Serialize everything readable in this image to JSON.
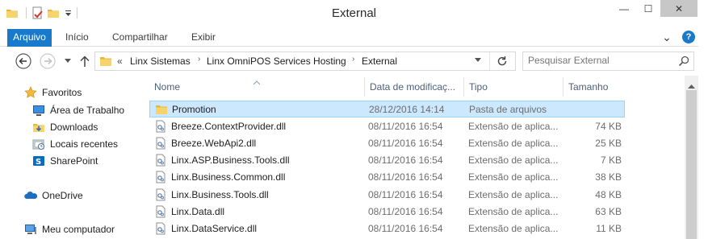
{
  "window": {
    "title": "External",
    "minimize_glyph": "—",
    "maximize_glyph": "☐",
    "close_glyph": "✕"
  },
  "quick_access": {
    "icons": [
      "folder-icon",
      "properties-icon",
      "new-folder-icon",
      "dropdown-arrow-icon"
    ]
  },
  "ribbon": {
    "tabs": [
      {
        "label": "Arquivo",
        "active": true
      },
      {
        "label": "Início",
        "active": false
      },
      {
        "label": "Compartilhar",
        "active": false
      },
      {
        "label": "Exibir",
        "active": false
      }
    ],
    "expand_glyph": "⌄",
    "help_glyph": "?"
  },
  "address": {
    "overflow": "«",
    "breadcrumbs": [
      "Linx Sistemas",
      "Linx OmniPOS Services Hosting",
      "External"
    ],
    "separator": "›"
  },
  "search": {
    "placeholder": "Pesquisar External"
  },
  "nav_pane": {
    "items": [
      {
        "label": "Favoritos",
        "icon": "star-icon"
      },
      {
        "label": "Área de Trabalho",
        "icon": "desktop-icon"
      },
      {
        "label": "Downloads",
        "icon": "downloads-icon"
      },
      {
        "label": "Locais recentes",
        "icon": "recent-places-icon"
      },
      {
        "label": "SharePoint",
        "icon": "sharepoint-icon"
      },
      {
        "label": "OneDrive",
        "icon": "onedrive-icon"
      },
      {
        "label": "Meu computador",
        "icon": "computer-icon"
      }
    ]
  },
  "columns": {
    "name": "Nome",
    "date": "Data de modificaç...",
    "type": "Tipo",
    "size": "Tamanho"
  },
  "files": [
    {
      "name": "Promotion",
      "date": "28/12/2016 14:14",
      "type": "Pasta de arquivos",
      "size": "",
      "icon": "folder-icon",
      "selected": true
    },
    {
      "name": "Breeze.ContextProvider.dll",
      "date": "08/11/2016 16:54",
      "type": "Extensão de aplica...",
      "size": "74 KB",
      "icon": "dll-icon",
      "selected": false
    },
    {
      "name": "Breeze.WebApi2.dll",
      "date": "08/11/2016 16:54",
      "type": "Extensão de aplica...",
      "size": "25 KB",
      "icon": "dll-icon",
      "selected": false
    },
    {
      "name": "Linx.ASP.Business.Tools.dll",
      "date": "08/11/2016 16:54",
      "type": "Extensão de aplica...",
      "size": "7 KB",
      "icon": "dll-icon",
      "selected": false
    },
    {
      "name": "Linx.Business.Common.dll",
      "date": "08/11/2016 16:54",
      "type": "Extensão de aplica...",
      "size": "38 KB",
      "icon": "dll-icon",
      "selected": false
    },
    {
      "name": "Linx.Business.Tools.dll",
      "date": "08/11/2016 16:54",
      "type": "Extensão de aplica...",
      "size": "48 KB",
      "icon": "dll-icon",
      "selected": false
    },
    {
      "name": "Linx.Data.dll",
      "date": "08/11/2016 16:54",
      "type": "Extensão de aplica...",
      "size": "63 KB",
      "icon": "dll-icon",
      "selected": false
    },
    {
      "name": "Linx.DataService.dll",
      "date": "08/11/2016 16:54",
      "type": "Extensão de aplica...",
      "size": "11 KB",
      "icon": "dll-icon",
      "selected": false
    }
  ],
  "colors": {
    "accent": "#1979ca",
    "selection_fill": "#cce8ff",
    "selection_border": "#99d1ff",
    "folder": "#e8b735",
    "column_header_text": "#4c607a"
  }
}
